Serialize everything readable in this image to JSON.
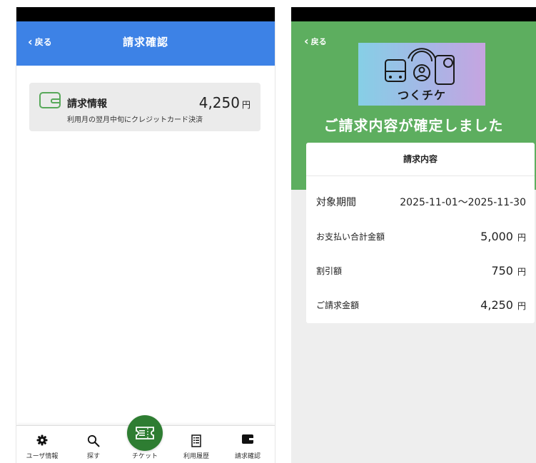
{
  "screen1": {
    "header": {
      "back_label": "戻る",
      "title": "請求確認"
    },
    "billing_card": {
      "title": "請求情報",
      "amount": "4,250",
      "currency": "円",
      "subtitle": "利用月の翌月中旬にクレジットカード決済"
    },
    "tabbar": {
      "items": [
        {
          "label": "ユーザ情報",
          "icon": "gear-icon"
        },
        {
          "label": "探す",
          "icon": "search-icon"
        },
        {
          "label": "チケット",
          "icon": "ticket-icon"
        },
        {
          "label": "利用履歴",
          "icon": "history-icon"
        },
        {
          "label": "請求確認",
          "icon": "wallet-icon"
        }
      ]
    }
  },
  "screen2": {
    "back_label": "戻る",
    "logo_text": "つくチケ",
    "confirm_title": "ご請求内容が確定しました",
    "detail": {
      "heading": "請求内容",
      "period_label": "対象期間",
      "period_value": "2025-11-01〜2025-11-30",
      "total_label": "お支払い合計金額",
      "total_value": "5,000",
      "discount_label": "割引額",
      "discount_value": "750",
      "billed_label": "ご請求金額",
      "billed_value": "4,250",
      "currency": "円"
    }
  },
  "colors": {
    "header_blue": "#3d82e6",
    "brand_green": "#5dae5f",
    "ticket_green": "#2e7d32"
  }
}
